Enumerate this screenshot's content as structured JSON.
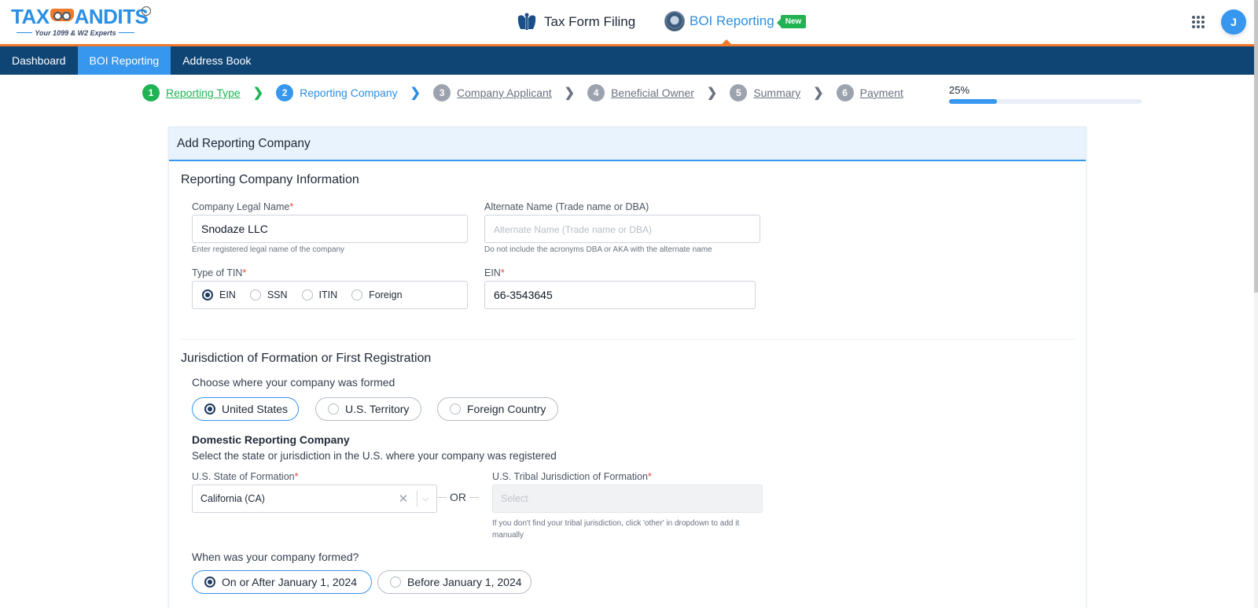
{
  "header": {
    "logo": {
      "left": "TAX",
      "right": "ANDITS",
      "tagline": "Your 1099 & W2 Experts",
      "tm": "TM"
    },
    "products": [
      {
        "label": "Tax Form Filing",
        "icon": "irs-eagle-icon"
      },
      {
        "label": "BOI Reporting",
        "icon": "fincen-seal-icon",
        "badge": "New",
        "active": true
      }
    ],
    "avatar_initial": "J"
  },
  "nav": {
    "items": [
      {
        "label": "Dashboard",
        "active": false
      },
      {
        "label": "BOI Reporting",
        "active": true
      },
      {
        "label": "Address Book",
        "active": false
      }
    ]
  },
  "stepper": {
    "steps": [
      {
        "num": "1",
        "label": "Reporting Type",
        "state": "done"
      },
      {
        "num": "2",
        "label": "Reporting Company",
        "state": "current"
      },
      {
        "num": "3",
        "label": "Company Applicant",
        "state": "pending"
      },
      {
        "num": "4",
        "label": "Beneficial Owner",
        "state": "pending"
      },
      {
        "num": "5",
        "label": "Summary",
        "state": "pending"
      },
      {
        "num": "6",
        "label": "Payment",
        "state": "pending"
      }
    ],
    "progress_text": "25%",
    "progress_percent": 25
  },
  "form": {
    "card_title": "Add Reporting Company",
    "info_section": {
      "title": "Reporting Company Information",
      "legal_name": {
        "label": "Company Legal Name",
        "required": "*",
        "value": "Snodaze LLC",
        "hint": "Enter registered legal name of the company"
      },
      "alternate_name": {
        "label": "Alternate Name (Trade name or DBA)",
        "placeholder": "Alternate Name (Trade name or DBA)",
        "value": "",
        "hint": "Do not include the acronyms DBA or AKA with the alternate name"
      },
      "tin_type": {
        "label": "Type of TIN",
        "required": "*",
        "options": [
          "EIN",
          "SSN",
          "ITIN",
          "Foreign"
        ],
        "selected": "EIN"
      },
      "ein": {
        "label": "EIN",
        "required": "*",
        "value": "66-3543645"
      }
    },
    "jurisdiction_section": {
      "title": "Jurisdiction of Formation or First Registration",
      "question": "Choose where your company was formed",
      "options": [
        "United States",
        "U.S. Territory",
        "Foreign Country"
      ],
      "selected": "United States",
      "domestic_title": "Domestic Reporting Company",
      "domestic_text": "Select the state or jurisdiction in the U.S. where your company was registered",
      "state": {
        "label": "U.S. State of Formation",
        "required": "*",
        "value": "California (CA)"
      },
      "or_label": "OR",
      "tribal": {
        "label": "U.S. Tribal Jurisdiction of Formation",
        "required": "*",
        "placeholder": "Select",
        "hint": "If you don't find your tribal jurisdiction, click 'other' in dropdown to add it manually"
      },
      "formed_question": "When was your company formed?",
      "formed_options": [
        "On or After January 1, 2024",
        "Before January 1, 2024"
      ],
      "formed_selected": "On or After January 1, 2024"
    }
  },
  "colors": {
    "brand_blue": "#3797ef",
    "nav_dark": "#0f4574",
    "accent_orange": "#ef7a2b",
    "success_green": "#1fb354"
  }
}
